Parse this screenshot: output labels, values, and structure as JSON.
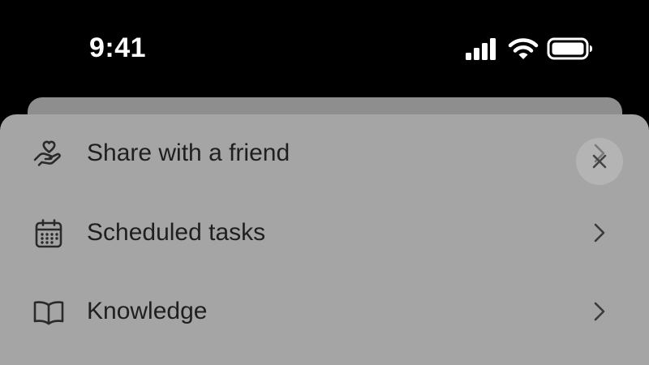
{
  "status_bar": {
    "time": "9:41",
    "icons": [
      "cellular-signal-icon",
      "wifi-icon",
      "battery-icon"
    ]
  },
  "menu": {
    "items": [
      {
        "label": "Share with a friend",
        "icon": "hand-heart-icon"
      },
      {
        "label": "Scheduled tasks",
        "icon": "calendar-icon"
      },
      {
        "label": "Knowledge",
        "icon": "book-open-icon"
      }
    ]
  },
  "close_button": {
    "icon": "close-icon"
  },
  "colors": {
    "background": "#000000",
    "sheet": "#a5a5a5",
    "back_card": "#8e8e8e",
    "text": "#1f1f1f",
    "status_text": "#ffffff"
  }
}
